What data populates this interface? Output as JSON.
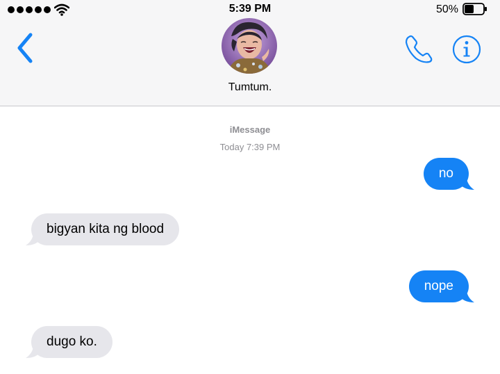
{
  "status_bar": {
    "signal_dots": 5,
    "time": "5:39 PM",
    "battery_percent": "50%",
    "battery_level": 0.5
  },
  "header": {
    "contact_name": "Tumtum.",
    "back_icon": "chevron-left-icon",
    "call_icon": "phone-icon",
    "info_icon": "info-icon",
    "accent_color": "#1583f5"
  },
  "conversation": {
    "service": "iMessage",
    "timestamp": "Today 7:39 PM",
    "messages": [
      {
        "direction": "sent",
        "text": "no"
      },
      {
        "direction": "received",
        "text": "bigyan kita ng blood"
      },
      {
        "direction": "sent",
        "text": "nope"
      },
      {
        "direction": "received",
        "text": "dugo ko."
      }
    ]
  },
  "colors": {
    "sent_bubble": "#1583f5",
    "received_bubble": "#e6e6eb",
    "header_background": "#f6f6f7",
    "meta_text": "#8e8e93"
  }
}
